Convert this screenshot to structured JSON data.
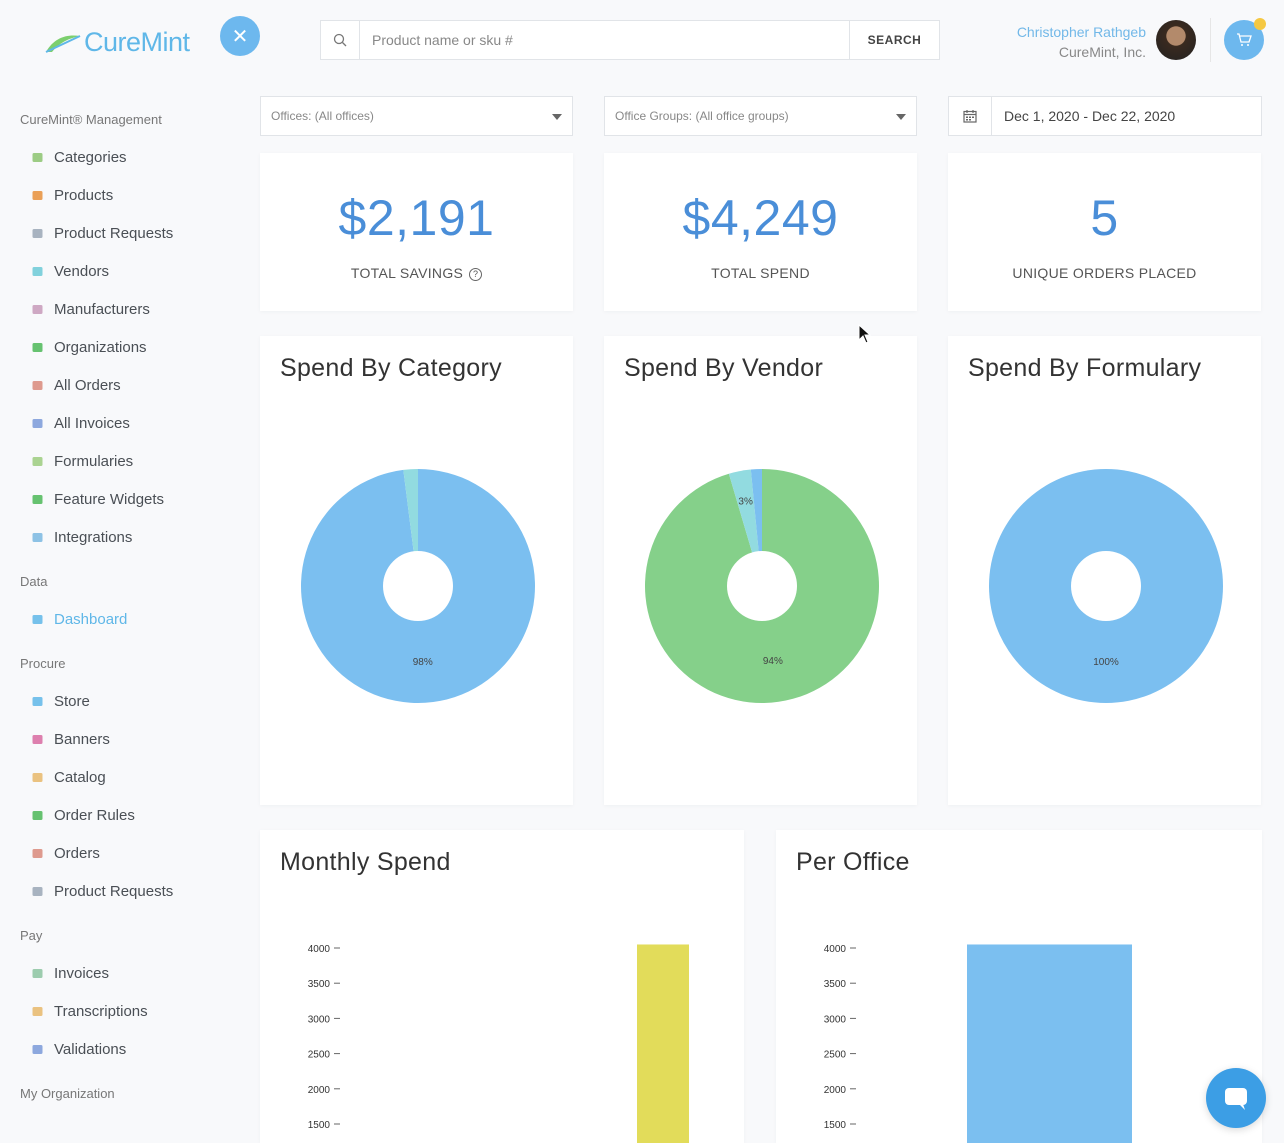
{
  "header": {
    "logo_text": "CureMint",
    "search_placeholder": "Product name or sku #",
    "search_button": "SEARCH",
    "user_name": "Christopher Rathgeb",
    "user_org": "CureMint, Inc."
  },
  "sidebar": {
    "sections": [
      {
        "title": "CureMint® Management",
        "items": [
          {
            "label": "Categories",
            "icon": "sitemap-icon",
            "color": "#8cc46f"
          },
          {
            "label": "Products",
            "icon": "product-icon",
            "color": "#e8913a"
          },
          {
            "label": "Product Requests",
            "icon": "lightbulb-icon",
            "color": "#9aa7b5"
          },
          {
            "label": "Vendors",
            "icon": "store-icon",
            "color": "#6ccad6"
          },
          {
            "label": "Manufacturers",
            "icon": "factory-icon",
            "color": "#c79ab8"
          },
          {
            "label": "Organizations",
            "icon": "bookmark-icon",
            "color": "#4cb857"
          },
          {
            "label": "All Orders",
            "icon": "tag-icon",
            "color": "#d98a7a"
          },
          {
            "label": "All Invoices",
            "icon": "invoice-icon",
            "color": "#7a9ad8"
          },
          {
            "label": "Formularies",
            "icon": "table-icon",
            "color": "#9ccc7e"
          },
          {
            "label": "Feature Widgets",
            "icon": "comment-icon",
            "color": "#4cb857"
          },
          {
            "label": "Integrations",
            "icon": "integration-icon",
            "color": "#7ab8e0"
          }
        ]
      },
      {
        "title": "Data",
        "items": [
          {
            "label": "Dashboard",
            "icon": "dashboard-icon",
            "color": "#5fb7e8",
            "active": true
          }
        ]
      },
      {
        "title": "Procure",
        "items": [
          {
            "label": "Store",
            "icon": "store-icon",
            "color": "#5fb7e8"
          },
          {
            "label": "Banners",
            "icon": "gear-icon",
            "color": "#d86aa0"
          },
          {
            "label": "Catalog",
            "icon": "book-icon",
            "color": "#e8b86a"
          },
          {
            "label": "Order Rules",
            "icon": "circle-dot-icon",
            "color": "#4cb857"
          },
          {
            "label": "Orders",
            "icon": "tag-icon",
            "color": "#d98a7a"
          },
          {
            "label": "Product Requests",
            "icon": "lightbulb-icon",
            "color": "#9aa7b5"
          }
        ]
      },
      {
        "title": "Pay",
        "items": [
          {
            "label": "Invoices",
            "icon": "invoice-icon",
            "color": "#8cc4a0"
          },
          {
            "label": "Transcriptions",
            "icon": "book-icon",
            "color": "#e8b86a"
          },
          {
            "label": "Validations",
            "icon": "check-icon",
            "color": "#7a9ad8"
          }
        ]
      },
      {
        "title": "My Organization",
        "items": []
      }
    ]
  },
  "filters": {
    "offices": "Offices: (All offices)",
    "office_groups": "Office Groups: (All office groups)",
    "date_range": "Dec 1, 2020 - Dec 22, 2020"
  },
  "stats": [
    {
      "value": "$2,191",
      "label": "TOTAL SAVINGS",
      "help": true
    },
    {
      "value": "$4,249",
      "label": "TOTAL SPEND",
      "help": false
    },
    {
      "value": "5",
      "label": "UNIQUE ORDERS PLACED",
      "help": false
    }
  ],
  "pies": [
    {
      "title": "Spend By Category",
      "slices": [
        {
          "value": 98,
          "color": "#7bbff0",
          "label": "98%"
        },
        {
          "value": 2,
          "color": "#92dbe0",
          "label": ""
        }
      ]
    },
    {
      "title": "Spend By Vendor",
      "slices": [
        {
          "value": 94,
          "color": "#85d08a",
          "label": "94%"
        },
        {
          "value": 3,
          "color": "#92dbe0",
          "label": "3%"
        },
        {
          "value": 1.5,
          "color": "#7bbff0",
          "label": ""
        }
      ]
    },
    {
      "title": "Spend By Formulary",
      "slices": [
        {
          "value": 100,
          "color": "#7bbff0",
          "label": "100%"
        }
      ]
    }
  ],
  "bar_charts": [
    {
      "title": "Monthly Spend",
      "ticks": [
        "4000",
        "3500",
        "3000",
        "2500",
        "2000",
        "1500"
      ],
      "bar_color": "#e2dc5a"
    },
    {
      "title": "Per Office",
      "ticks": [
        "4000",
        "3500",
        "3000",
        "2500",
        "2000",
        "1500"
      ],
      "bar_color": "#7bbff0"
    }
  ],
  "chart_data": [
    {
      "type": "bar",
      "title": "Monthly Spend",
      "ylim": [
        1500,
        4000
      ],
      "series": [
        {
          "values": [
            4249
          ]
        }
      ]
    },
    {
      "type": "bar",
      "title": "Per Office",
      "ylim": [
        1500,
        4000
      ],
      "series": [
        {
          "values": [
            4249
          ]
        }
      ]
    }
  ]
}
